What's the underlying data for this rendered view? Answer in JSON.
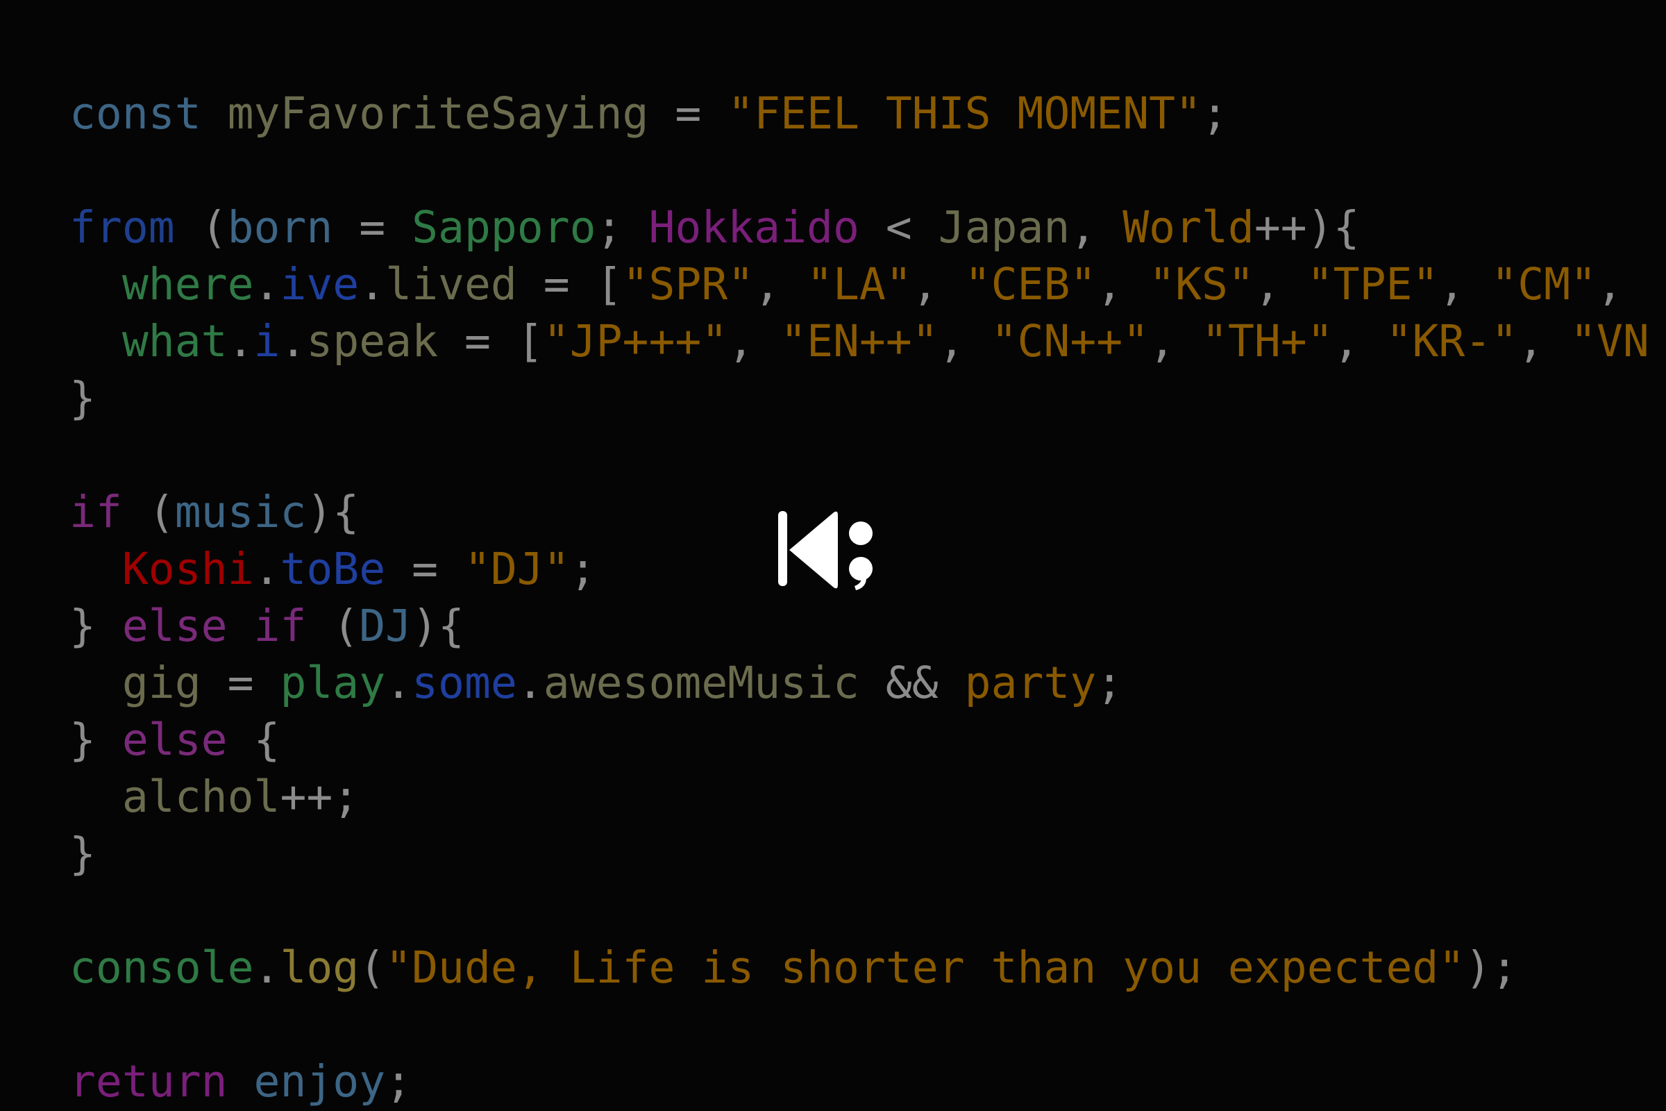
{
  "banner": {
    "background_color": "#050505",
    "logo": {
      "name": "K;",
      "color": "#ffffff"
    }
  },
  "code": {
    "language": "javascript",
    "font": "monospace",
    "lines": [
      {
        "index": 1,
        "text": "const myFavoriteSaying = \"FEEL THIS MOMENT\";",
        "tokens": [
          {
            "text": "const",
            "color": "#3d6585"
          },
          {
            "text": " ",
            "color": "#8c8c8c"
          },
          {
            "text": "myFavoriteSaying",
            "color": "#6b6b4e"
          },
          {
            "text": " = ",
            "color": "#8c8c8c"
          },
          {
            "text": "\"FEEL THIS MOMENT\"",
            "color": "#8a5a00"
          },
          {
            "text": ";",
            "color": "#8c8c8c"
          }
        ]
      },
      {
        "index": 2,
        "text": "",
        "tokens": []
      },
      {
        "index": 3,
        "text": "from (born = Sapporo; Hokkaido < Japan, World++){",
        "tokens": [
          {
            "text": "from",
            "color": "#1f3f8f"
          },
          {
            "text": " (",
            "color": "#8c8c8c"
          },
          {
            "text": "born",
            "color": "#3d6585"
          },
          {
            "text": " = ",
            "color": "#8c8c8c"
          },
          {
            "text": "Sapporo",
            "color": "#2f7a45"
          },
          {
            "text": "; ",
            "color": "#8c8c8c"
          },
          {
            "text": "Hokkaido",
            "color": "#7a1f7a"
          },
          {
            "text": " < ",
            "color": "#8c8c8c"
          },
          {
            "text": "Japan",
            "color": "#6b6b4e"
          },
          {
            "text": ", ",
            "color": "#8c8c8c"
          },
          {
            "text": "World",
            "color": "#8a5a00"
          },
          {
            "text": "++){",
            "color": "#8c8c8c"
          }
        ]
      },
      {
        "index": 4,
        "text": "  where.ive.lived = [\"SPR\", \"LA\", \"CEB\", \"KS\", \"TPE\", \"CM\",",
        "tokens": [
          {
            "text": "  ",
            "color": "#8c8c8c"
          },
          {
            "text": "where",
            "color": "#2f7a45"
          },
          {
            "text": ".",
            "color": "#8c8c8c"
          },
          {
            "text": "ive",
            "color": "#1f3f9f"
          },
          {
            "text": ".",
            "color": "#8c8c8c"
          },
          {
            "text": "lived",
            "color": "#6b6b4e"
          },
          {
            "text": " = [",
            "color": "#8c8c8c"
          },
          {
            "text": "\"SPR\"",
            "color": "#8a5a00"
          },
          {
            "text": ", ",
            "color": "#8c8c8c"
          },
          {
            "text": "\"LA\"",
            "color": "#8a5a00"
          },
          {
            "text": ", ",
            "color": "#8c8c8c"
          },
          {
            "text": "\"CEB\"",
            "color": "#8a5a00"
          },
          {
            "text": ", ",
            "color": "#8c8c8c"
          },
          {
            "text": "\"KS\"",
            "color": "#8a5a00"
          },
          {
            "text": ", ",
            "color": "#8c8c8c"
          },
          {
            "text": "\"TPE\"",
            "color": "#8a5a00"
          },
          {
            "text": ", ",
            "color": "#8c8c8c"
          },
          {
            "text": "\"CM\"",
            "color": "#8a5a00"
          },
          {
            "text": ",",
            "color": "#8c8c8c"
          }
        ]
      },
      {
        "index": 5,
        "text": "  what.i.speak = [\"JP+++\", \"EN++\", \"CN++\", \"TH+\", \"KR-\", \"VN",
        "tokens": [
          {
            "text": "  ",
            "color": "#8c8c8c"
          },
          {
            "text": "what",
            "color": "#2f7a45"
          },
          {
            "text": ".",
            "color": "#8c8c8c"
          },
          {
            "text": "i",
            "color": "#1f3f9f"
          },
          {
            "text": ".",
            "color": "#8c8c8c"
          },
          {
            "text": "speak",
            "color": "#6b6b4e"
          },
          {
            "text": " = [",
            "color": "#8c8c8c"
          },
          {
            "text": "\"JP+++\"",
            "color": "#8a5a00"
          },
          {
            "text": ", ",
            "color": "#8c8c8c"
          },
          {
            "text": "\"EN++\"",
            "color": "#8a5a00"
          },
          {
            "text": ", ",
            "color": "#8c8c8c"
          },
          {
            "text": "\"CN++\"",
            "color": "#8a5a00"
          },
          {
            "text": ", ",
            "color": "#8c8c8c"
          },
          {
            "text": "\"TH+\"",
            "color": "#8a5a00"
          },
          {
            "text": ", ",
            "color": "#8c8c8c"
          },
          {
            "text": "\"KR-\"",
            "color": "#8a5a00"
          },
          {
            "text": ", ",
            "color": "#8c8c8c"
          },
          {
            "text": "\"VN",
            "color": "#8a5a00"
          }
        ]
      },
      {
        "index": 6,
        "text": "}",
        "tokens": [
          {
            "text": "}",
            "color": "#8c8c8c"
          }
        ]
      },
      {
        "index": 7,
        "text": "",
        "tokens": []
      },
      {
        "index": 8,
        "text": "if (music){",
        "tokens": [
          {
            "text": "if",
            "color": "#7a2a7a"
          },
          {
            "text": " (",
            "color": "#8c8c8c"
          },
          {
            "text": "music",
            "color": "#3d6585"
          },
          {
            "text": "){",
            "color": "#8c8c8c"
          }
        ]
      },
      {
        "index": 9,
        "text": "  Koshi.toBe = \"DJ\";",
        "tokens": [
          {
            "text": "  ",
            "color": "#8c8c8c"
          },
          {
            "text": "Koshi",
            "color": "#9f0000"
          },
          {
            "text": ".",
            "color": "#8c8c8c"
          },
          {
            "text": "toBe",
            "color": "#1f3f9f"
          },
          {
            "text": " = ",
            "color": "#8c8c8c"
          },
          {
            "text": "\"DJ\"",
            "color": "#8a5a00"
          },
          {
            "text": ";",
            "color": "#8c8c8c"
          }
        ]
      },
      {
        "index": 10,
        "text": "} else if (DJ){",
        "tokens": [
          {
            "text": "} ",
            "color": "#8c8c8c"
          },
          {
            "text": "else if",
            "color": "#7a2a7a"
          },
          {
            "text": " (",
            "color": "#8c8c8c"
          },
          {
            "text": "DJ",
            "color": "#3d6585"
          },
          {
            "text": "){",
            "color": "#8c8c8c"
          }
        ]
      },
      {
        "index": 11,
        "text": "  gig = play.some.awesomeMusic && party;",
        "tokens": [
          {
            "text": "  ",
            "color": "#8c8c8c"
          },
          {
            "text": "gig",
            "color": "#6b6b4e"
          },
          {
            "text": " = ",
            "color": "#8c8c8c"
          },
          {
            "text": "play",
            "color": "#2f7a45"
          },
          {
            "text": ".",
            "color": "#8c8c8c"
          },
          {
            "text": "some",
            "color": "#1f3f9f"
          },
          {
            "text": ".",
            "color": "#8c8c8c"
          },
          {
            "text": "awesomeMusic",
            "color": "#6b6b4e"
          },
          {
            "text": " && ",
            "color": "#8c8c8c"
          },
          {
            "text": "party",
            "color": "#8a5a00"
          },
          {
            "text": ";",
            "color": "#8c8c8c"
          }
        ]
      },
      {
        "index": 12,
        "text": "} else {",
        "tokens": [
          {
            "text": "} ",
            "color": "#8c8c8c"
          },
          {
            "text": "else",
            "color": "#7a2a7a"
          },
          {
            "text": " {",
            "color": "#8c8c8c"
          }
        ]
      },
      {
        "index": 13,
        "text": "  alchol++;",
        "tokens": [
          {
            "text": "  ",
            "color": "#8c8c8c"
          },
          {
            "text": "alchol",
            "color": "#6b6b4e"
          },
          {
            "text": "++;",
            "color": "#8c8c8c"
          }
        ]
      },
      {
        "index": 14,
        "text": "}",
        "tokens": [
          {
            "text": "}",
            "color": "#8c8c8c"
          }
        ]
      },
      {
        "index": 15,
        "text": "",
        "tokens": []
      },
      {
        "index": 16,
        "text": "console.log(\"Dude, Life is shorter than you expected\");",
        "tokens": [
          {
            "text": "console",
            "color": "#2f7a45"
          },
          {
            "text": ".",
            "color": "#8c8c8c"
          },
          {
            "text": "log",
            "color": "#8a7a33"
          },
          {
            "text": "(",
            "color": "#8c8c8c"
          },
          {
            "text": "\"Dude, Life is shorter than you expected\"",
            "color": "#8a5a00"
          },
          {
            "text": ");",
            "color": "#8c8c8c"
          }
        ]
      },
      {
        "index": 17,
        "text": "",
        "tokens": []
      },
      {
        "index": 18,
        "text": "return enjoy;",
        "tokens": [
          {
            "text": "return",
            "color": "#7a1f7a"
          },
          {
            "text": " ",
            "color": "#8c8c8c"
          },
          {
            "text": "enjoy",
            "color": "#3d6585"
          },
          {
            "text": ";",
            "color": "#8c8c8c"
          }
        ]
      }
    ]
  }
}
